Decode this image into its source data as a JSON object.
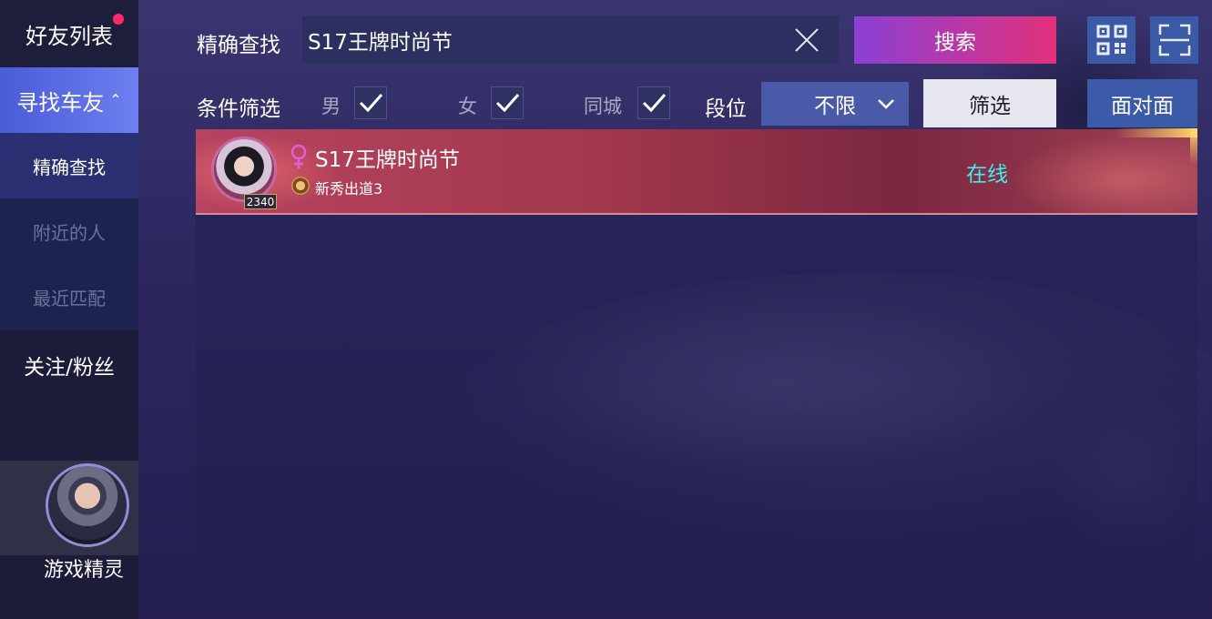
{
  "sidebar": {
    "friends_label": "好友列表",
    "find_label": "寻找车友",
    "find_chevron": "«",
    "exact_label": "精确查找",
    "nearby_label": "附近的人",
    "recent_label": "最近匹配",
    "follow_label": "关注/粉丝",
    "spirit_label": "游戏精灵"
  },
  "search": {
    "label": "精确查找",
    "value": "S17王牌时尚节",
    "button_label": "搜索"
  },
  "filters": {
    "label": "条件筛选",
    "male": "男",
    "female": "女",
    "same_city": "同城",
    "rank_label": "段位",
    "rank_value": "不限",
    "filter_button": "筛选",
    "face_to_face_button": "面对面"
  },
  "results": [
    {
      "name": "S17王牌时尚节",
      "level": "2340",
      "rank": "新秀出道3",
      "status": "在线"
    }
  ],
  "colors": {
    "accent_online": "#3ef0f0",
    "notification_dot": "#ff2a6a",
    "search_gradient_start": "#8b40d6",
    "search_gradient_end": "#e0307a"
  }
}
